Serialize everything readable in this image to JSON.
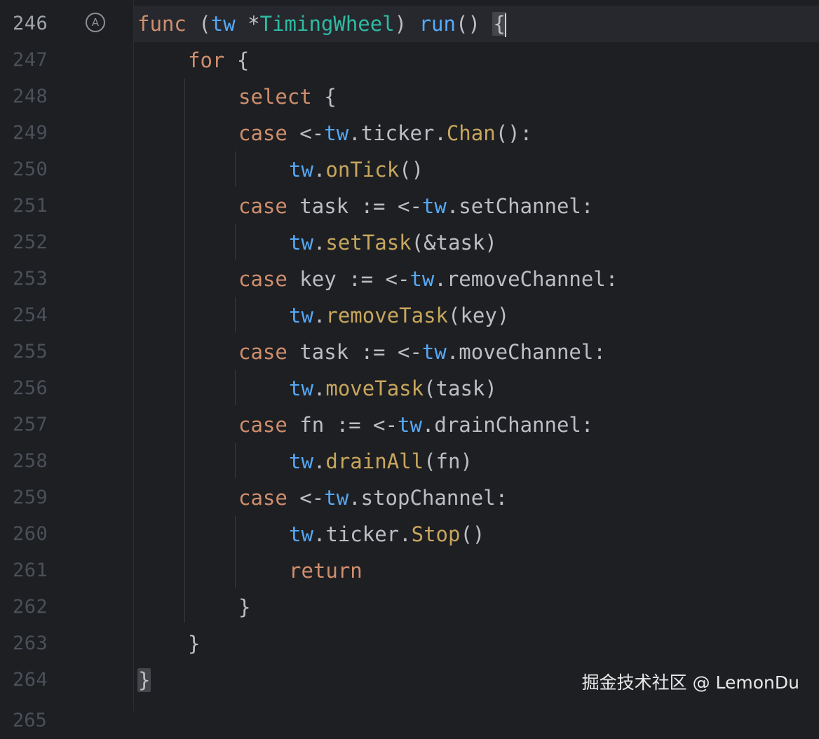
{
  "editor": {
    "gutter_icon": "A",
    "lines": [
      {
        "num": "246",
        "tokens": [
          {
            "t": "func",
            "c": "kw"
          },
          {
            "t": " (",
            "c": "plain"
          },
          {
            "t": "tw",
            "c": "tw"
          },
          {
            "t": " *",
            "c": "plain"
          },
          {
            "t": "TimingWheel",
            "c": "ty"
          },
          {
            "t": ") ",
            "c": "plain"
          },
          {
            "t": "run",
            "c": "fn"
          },
          {
            "t": "() ",
            "c": "plain"
          }
        ],
        "brace": "{"
      },
      {
        "num": "247",
        "tokens": [
          {
            "t": "for",
            "c": "kw"
          },
          {
            "t": " {",
            "c": "plain"
          }
        ]
      },
      {
        "num": "248",
        "tokens": [
          {
            "t": "select",
            "c": "kw"
          },
          {
            "t": " {",
            "c": "plain"
          }
        ]
      },
      {
        "num": "249",
        "tokens": [
          {
            "t": "case",
            "c": "kw"
          },
          {
            "t": " <-",
            "c": "plain"
          },
          {
            "t": "tw",
            "c": "tw"
          },
          {
            "t": ".ticker.",
            "c": "plain"
          },
          {
            "t": "Chan",
            "c": "mcall"
          },
          {
            "t": "():",
            "c": "plain"
          }
        ]
      },
      {
        "num": "250",
        "tokens": [
          {
            "t": "tw",
            "c": "tw"
          },
          {
            "t": ".",
            "c": "plain"
          },
          {
            "t": "onTick",
            "c": "mcall"
          },
          {
            "t": "()",
            "c": "plain"
          }
        ]
      },
      {
        "num": "251",
        "tokens": [
          {
            "t": "case",
            "c": "kw"
          },
          {
            "t": " task := <-",
            "c": "plain"
          },
          {
            "t": "tw",
            "c": "tw"
          },
          {
            "t": ".setChannel:",
            "c": "plain"
          }
        ]
      },
      {
        "num": "252",
        "tokens": [
          {
            "t": "tw",
            "c": "tw"
          },
          {
            "t": ".",
            "c": "plain"
          },
          {
            "t": "setTask",
            "c": "mcall"
          },
          {
            "t": "(&task)",
            "c": "plain"
          }
        ]
      },
      {
        "num": "253",
        "tokens": [
          {
            "t": "case",
            "c": "kw"
          },
          {
            "t": " key := <-",
            "c": "plain"
          },
          {
            "t": "tw",
            "c": "tw"
          },
          {
            "t": ".removeChannel:",
            "c": "plain"
          }
        ]
      },
      {
        "num": "254",
        "tokens": [
          {
            "t": "tw",
            "c": "tw"
          },
          {
            "t": ".",
            "c": "plain"
          },
          {
            "t": "removeTask",
            "c": "mcall"
          },
          {
            "t": "(key)",
            "c": "plain"
          }
        ]
      },
      {
        "num": "255",
        "tokens": [
          {
            "t": "case",
            "c": "kw"
          },
          {
            "t": " task := <-",
            "c": "plain"
          },
          {
            "t": "tw",
            "c": "tw"
          },
          {
            "t": ".moveChannel:",
            "c": "plain"
          }
        ]
      },
      {
        "num": "256",
        "tokens": [
          {
            "t": "tw",
            "c": "tw"
          },
          {
            "t": ".",
            "c": "plain"
          },
          {
            "t": "moveTask",
            "c": "mcall"
          },
          {
            "t": "(task)",
            "c": "plain"
          }
        ]
      },
      {
        "num": "257",
        "tokens": [
          {
            "t": "case",
            "c": "kw"
          },
          {
            "t": " fn := <-",
            "c": "plain"
          },
          {
            "t": "tw",
            "c": "tw"
          },
          {
            "t": ".drainChannel:",
            "c": "plain"
          }
        ]
      },
      {
        "num": "258",
        "tokens": [
          {
            "t": "tw",
            "c": "tw"
          },
          {
            "t": ".",
            "c": "plain"
          },
          {
            "t": "drainAll",
            "c": "mcall"
          },
          {
            "t": "(fn)",
            "c": "plain"
          }
        ]
      },
      {
        "num": "259",
        "tokens": [
          {
            "t": "case",
            "c": "kw"
          },
          {
            "t": " <-",
            "c": "plain"
          },
          {
            "t": "tw",
            "c": "tw"
          },
          {
            "t": ".stopChannel:",
            "c": "plain"
          }
        ]
      },
      {
        "num": "260",
        "tokens": [
          {
            "t": "tw",
            "c": "tw"
          },
          {
            "t": ".ticker.",
            "c": "plain"
          },
          {
            "t": "Stop",
            "c": "mcall"
          },
          {
            "t": "()",
            "c": "plain"
          }
        ]
      },
      {
        "num": "261",
        "tokens": [
          {
            "t": "return",
            "c": "kw"
          }
        ]
      },
      {
        "num": "262",
        "tokens": [
          {
            "t": "}",
            "c": "plain"
          }
        ]
      },
      {
        "num": "263",
        "tokens": [
          {
            "t": "}",
            "c": "plain"
          }
        ]
      },
      {
        "num": "264",
        "tokens": [],
        "brace": "}"
      }
    ],
    "partial_line_number": "265"
  },
  "watermark": "掘金技术社区 @ LemonDu",
  "colors": {
    "background": "#1e1f22",
    "keyword": "#cf8e6d",
    "receiver": "#56a8f5",
    "type": "#2fbaa3",
    "method_call": "#c7a65d",
    "text": "#bcbec4"
  }
}
